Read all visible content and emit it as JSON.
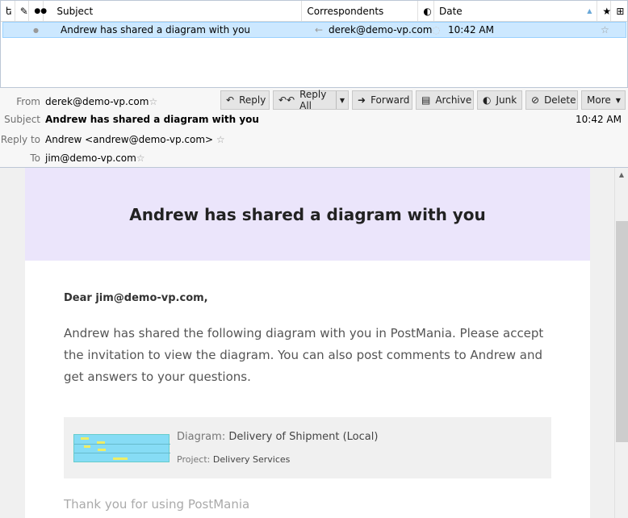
{
  "list": {
    "columns": [
      "Subject",
      "Correspondents",
      "Date"
    ],
    "row": {
      "subject": "Andrew has shared a diagram with you",
      "correspondent": "derek@demo-vp.com",
      "date": "10:42 AM"
    }
  },
  "header": {
    "from_label": "From",
    "from": "derek@demo-vp.com",
    "subject_label": "Subject",
    "subject": "Andrew has shared a diagram with you",
    "replyto_label": "Reply to",
    "replyto": "Andrew <andrew@demo-vp.com>",
    "to_label": "To",
    "to": "jim@demo-vp.com",
    "date": "10:42 AM",
    "buttons": {
      "reply": "Reply",
      "reply_all": "Reply All",
      "forward": "Forward",
      "archive": "Archive",
      "junk": "Junk",
      "delete": "Delete",
      "more": "More"
    }
  },
  "body": {
    "title": "Andrew has shared a diagram with you",
    "greeting": "Dear jim@demo-vp.com,",
    "paragraph": "Andrew has shared the following diagram with you in PostMania. Please accept the invitation to view the diagram. You can also post comments to Andrew and get answers to your questions.",
    "diagram_label": "Diagram:",
    "diagram": "Delivery of Shipment (Local)",
    "project_label": "Project:",
    "project": "Delivery Services",
    "footer": "Thank you for using PostMania"
  }
}
